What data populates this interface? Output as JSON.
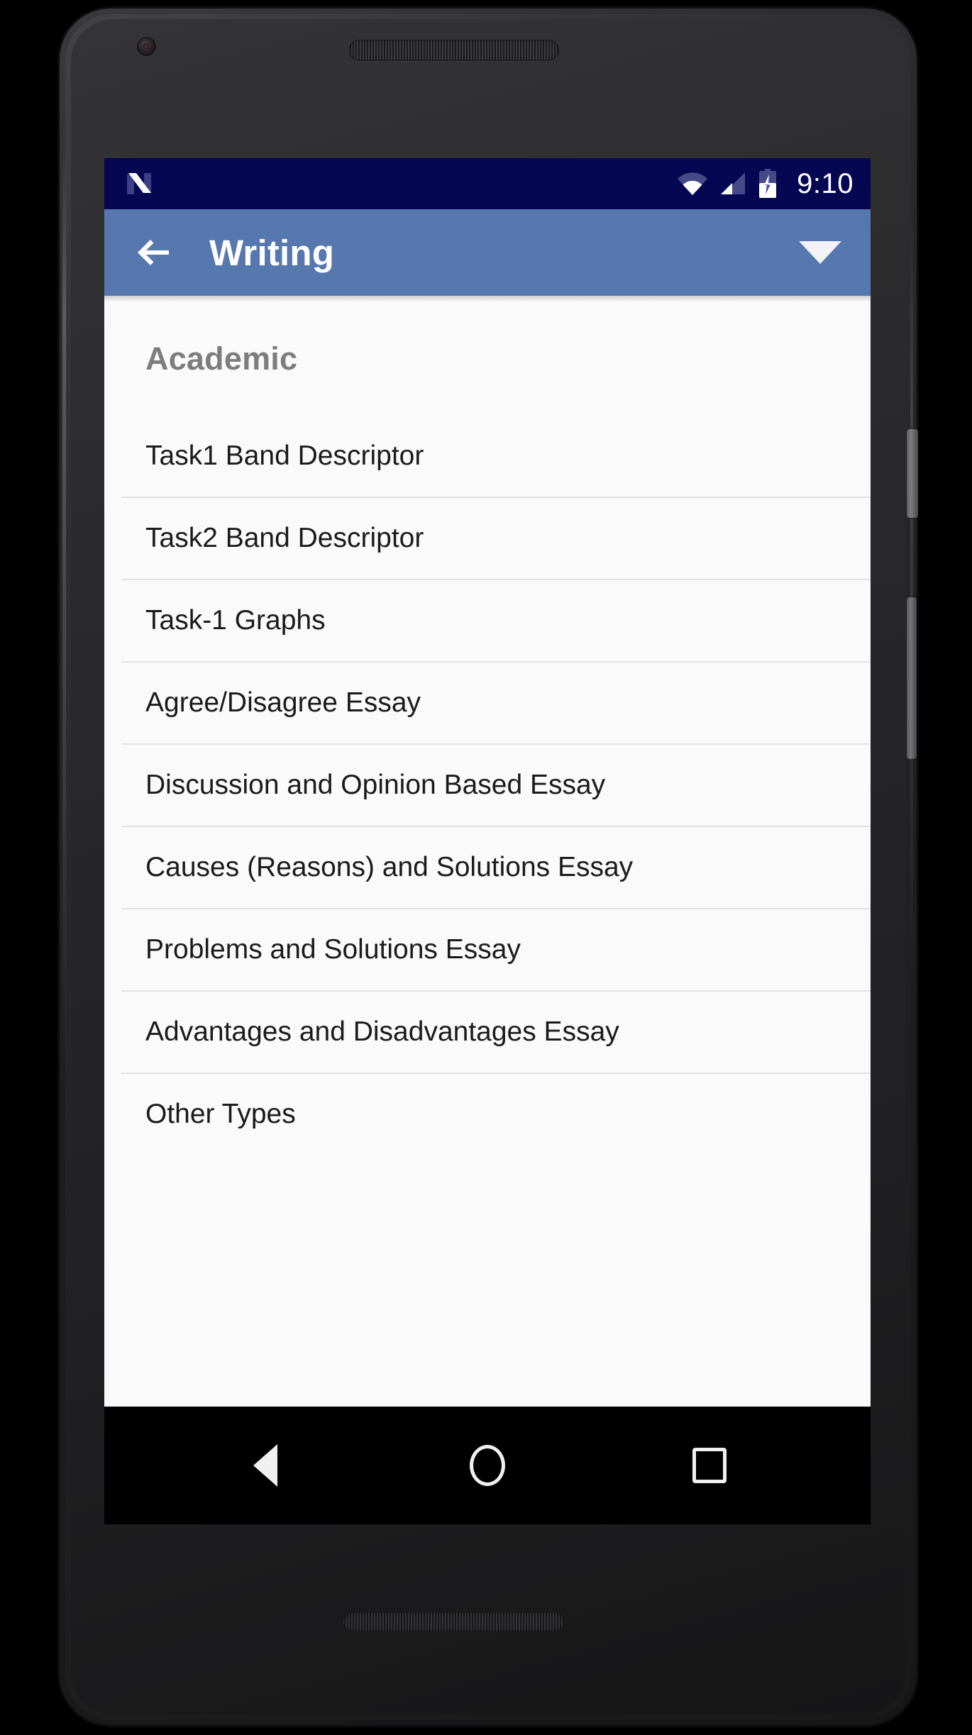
{
  "status_bar": {
    "os_logo": "android-n-logo",
    "icons": [
      "wifi-icon",
      "cellular-signal-icon",
      "battery-charging-icon"
    ],
    "time": "9:10",
    "background_color": "#050753"
  },
  "app_bar": {
    "back_icon": "arrow-left-icon",
    "title": "Writing",
    "dropdown_icon": "caret-down-icon",
    "background_color": "#5778AE",
    "text_color": "#FFFFFF"
  },
  "content": {
    "section_header": "Academic",
    "section_header_color": "#7D7D7D",
    "background_color": "#FAFAFA",
    "divider_color": "#E2E2E2",
    "items": [
      {
        "label": "Task1 Band Descriptor"
      },
      {
        "label": "Task2 Band Descriptor"
      },
      {
        "label": "Task-1 Graphs"
      },
      {
        "label": "Agree/Disagree Essay"
      },
      {
        "label": "Discussion and Opinion Based Essay"
      },
      {
        "label": "Causes (Reasons) and Solutions Essay"
      },
      {
        "label": "Problems and Solutions Essay"
      },
      {
        "label": "Advantages and Disadvantages Essay"
      },
      {
        "label": "Other Types"
      }
    ]
  },
  "nav_bar": {
    "background_color": "#000000",
    "buttons": [
      {
        "name": "back",
        "icon": "triangle-back-icon"
      },
      {
        "name": "home",
        "icon": "circle-home-icon"
      },
      {
        "name": "recents",
        "icon": "square-recents-icon"
      }
    ]
  },
  "device": {
    "hardware": [
      "front-camera",
      "earpiece-speaker",
      "bottom-speaker",
      "power-button",
      "volume-button"
    ],
    "body_color": "#2A2A2C"
  }
}
